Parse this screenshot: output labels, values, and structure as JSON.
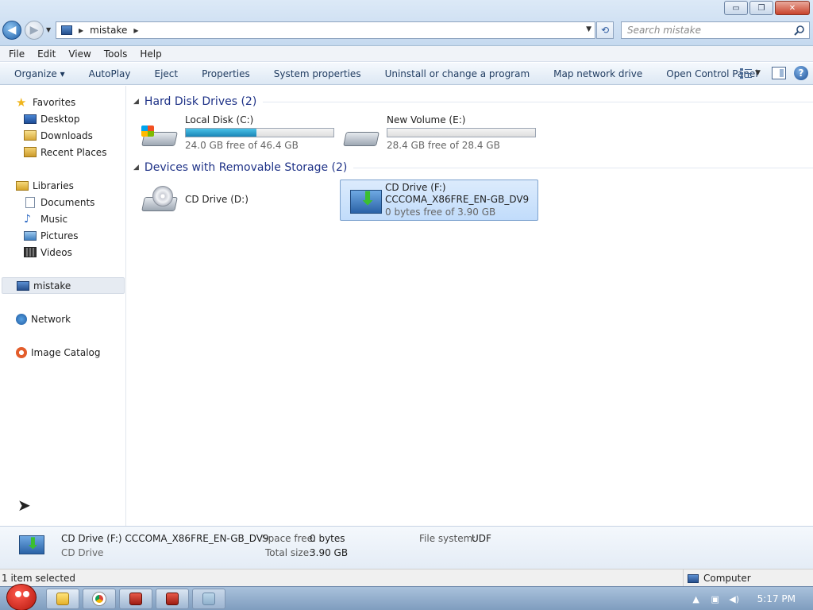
{
  "window": {
    "controls": {
      "minimize": "▭",
      "maximize": "❐",
      "close": "✕"
    }
  },
  "address": {
    "path": [
      "mistake"
    ],
    "search_placeholder": "Search mistake"
  },
  "menubar": {
    "items": [
      "File",
      "Edit",
      "View",
      "Tools",
      "Help"
    ]
  },
  "toolbar": {
    "commands": [
      "Organize ▾",
      "AutoPlay",
      "Eject",
      "Properties",
      "System properties",
      "Uninstall or change a program",
      "Map network drive",
      "Open Control Panel"
    ]
  },
  "navpane": {
    "favorites": {
      "label": "Favorites",
      "items": [
        "Desktop",
        "Downloads",
        "Recent Places"
      ]
    },
    "libraries": {
      "label": "Libraries",
      "items": [
        "Documents",
        "Music",
        "Pictures",
        "Videos"
      ]
    },
    "computer": "mistake",
    "network": "Network",
    "image_catalog": "Image Catalog"
  },
  "content": {
    "groups": [
      {
        "title": "Hard Disk Drives (2)",
        "drives": [
          {
            "name": "Local Disk (C:)",
            "free": "24.0 GB free of 46.4 GB",
            "used_fraction": 0.48
          },
          {
            "name": "New Volume (E:)",
            "free": "28.4 GB free of 28.4 GB",
            "used_fraction": 0.0
          }
        ]
      },
      {
        "title": "Devices with Removable Storage (2)",
        "drives": [
          {
            "name": "CD Drive (D:)"
          },
          {
            "name": "CD Drive (F:)",
            "label": "CCCOMA_X86FRE_EN-GB_DV9",
            "free": "0 bytes free of 3.90 GB",
            "selected": true
          }
        ]
      }
    ]
  },
  "details": {
    "title": "CD Drive (F:) CCCOMA_X86FRE_EN-GB_DV9",
    "type": "CD Drive",
    "space_free_label": "Space free:",
    "space_free_value": "0 bytes",
    "total_size_label": "Total size:",
    "total_size_value": "3.90 GB",
    "file_system_label": "File system:",
    "file_system_value": "UDF"
  },
  "statusbar": {
    "selection": "1 item selected",
    "location": "Computer"
  },
  "taskbar": {
    "clock": "5:17 PM"
  }
}
